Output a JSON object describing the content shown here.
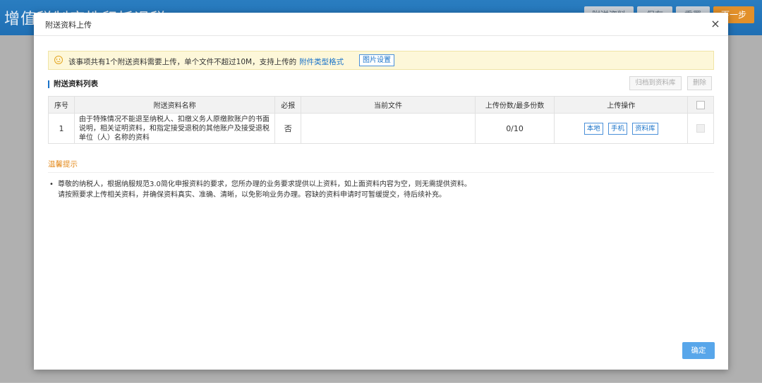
{
  "background": {
    "page_title": "增值税制度性留抵退税",
    "buttons": [
      "附送资料",
      "保存",
      "重置",
      "下一步"
    ]
  },
  "modal": {
    "title": "附送资料上传",
    "close_glyph": "×",
    "notice": {
      "text": "该事项共有1个附送资料需要上传，单个文件不超过10M，支持上传的",
      "link": "附件类型格式",
      "image_settings_button": "图片设置"
    },
    "section_title": "附送资料列表",
    "archive_button": "归档到资料库",
    "delete_button": "删除",
    "table": {
      "headers": [
        "序号",
        "附送资料名称",
        "必报",
        "当前文件",
        "上传份数/最多份数",
        "上传操作"
      ],
      "rows": [
        {
          "index": "1",
          "name": "由于特殊情况不能退至纳税人、扣缴义务人原缴款账户的书面说明，相关证明资料，和指定接受退税的其他账户及接受退税单位（人）名称的资料",
          "required": "否",
          "current_file": "",
          "count": "0/10",
          "actions": [
            "本地",
            "手机",
            "资料库"
          ]
        }
      ]
    },
    "tips": {
      "title": "温馨提示",
      "lines": [
        "尊敬的纳税人，根据纳服规范3.0简化申报资料的要求，您所办理的业务要求提供以上资料，如上面资料内容为空，则无需提供资料。",
        "请按照要求上传相关资料，并确保资料真实、准确、清晰，以免影响业务办理。容缺的资料申请时可暂缓提交，待后续补充。"
      ]
    },
    "ok_button": "确定"
  },
  "colors": {
    "accent": "#1a73c9",
    "tips_title": "#e48b1e",
    "ok_button": "#58a6ea",
    "notice_bg": "#fdf7d9",
    "header_bg": "#1f6fb4"
  }
}
